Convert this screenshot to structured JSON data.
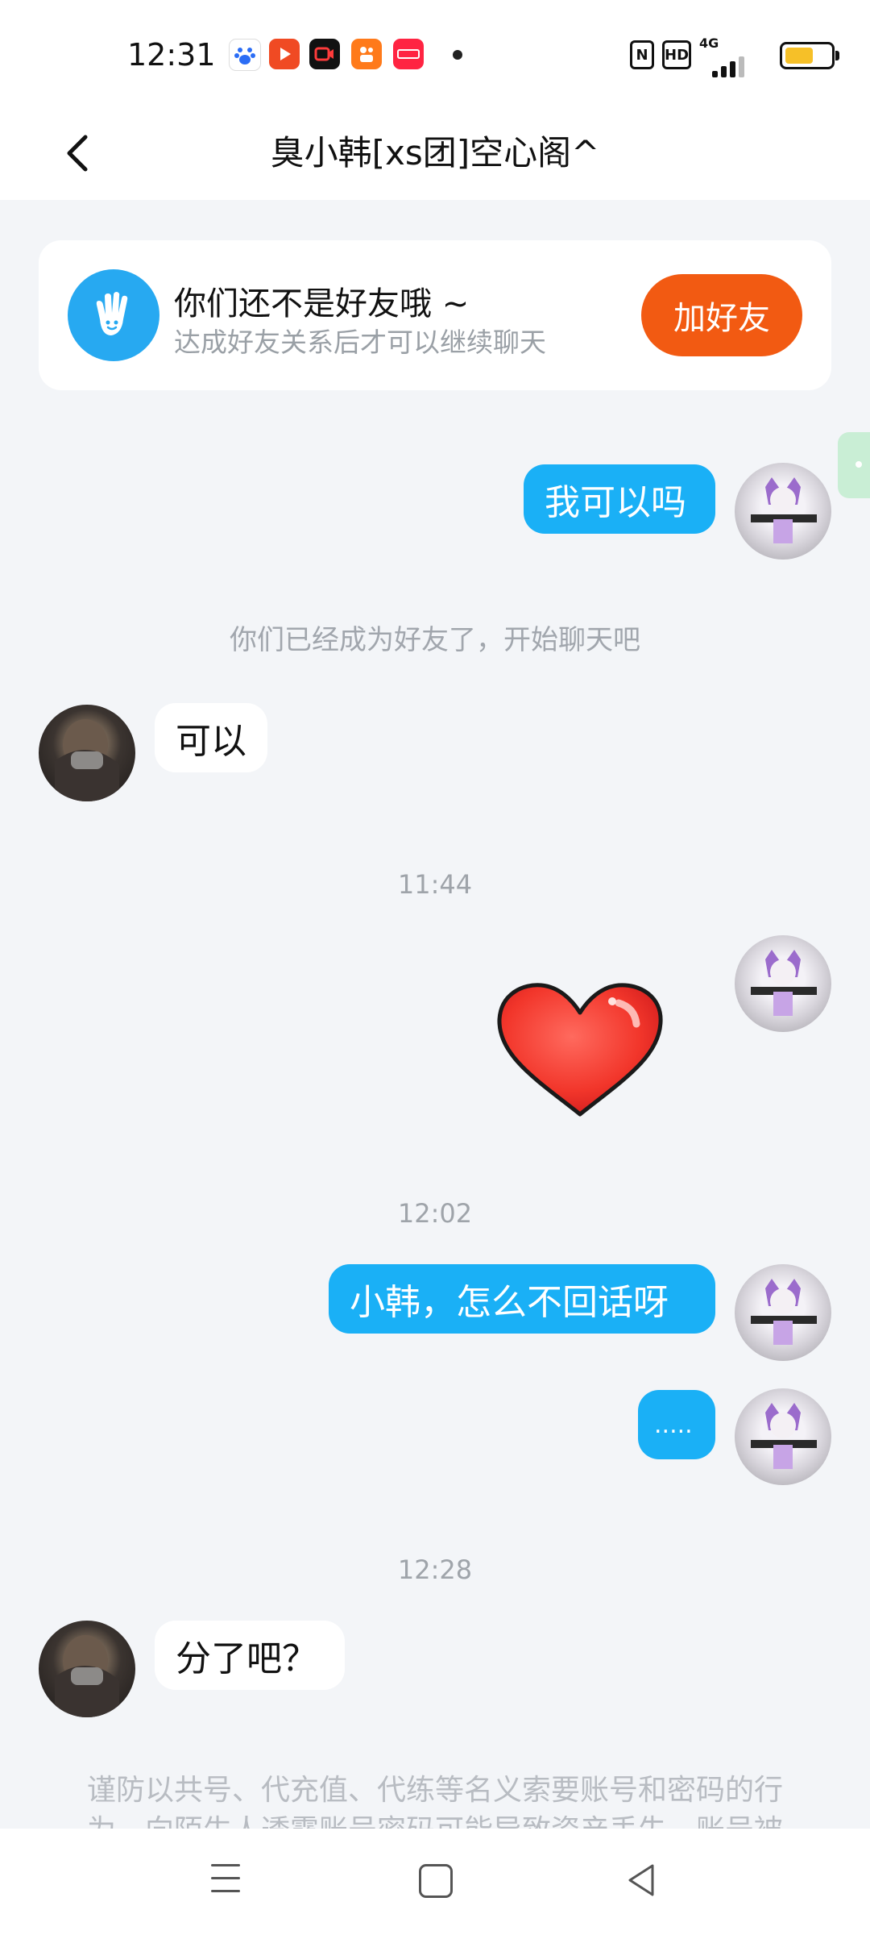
{
  "status_bar": {
    "time": "12:31",
    "apps": [
      {
        "icon": "baidu-icon",
        "color": "#2b6df5"
      },
      {
        "icon": "video-player-icon",
        "color": "#f04a23"
      },
      {
        "icon": "camera-recorder-icon",
        "color": "#111111"
      },
      {
        "icon": "kuaishou-icon",
        "color": "#ff7a1a"
      },
      {
        "icon": "xiaohongshu-icon",
        "color": "#ff2442"
      }
    ],
    "nfc": "N",
    "hd": "HD",
    "network": "4G"
  },
  "header": {
    "title": "臭小韩[xs团]空心阁^"
  },
  "friend_card": {
    "title": "你们还不是好友哦 ~",
    "subtitle": "达成好友关系后才可以继续聊天",
    "button": "加好友"
  },
  "messages": [
    {
      "side": "out",
      "text": "我可以吗"
    },
    {
      "system": "你们已经成为好友了，开始聊天吧"
    },
    {
      "side": "in",
      "text": "可以"
    },
    {
      "time": "11:44"
    },
    {
      "side": "out",
      "sticker": "red-heart"
    },
    {
      "time": "12:02"
    },
    {
      "side": "out",
      "text": "小韩，怎么不回话呀"
    },
    {
      "side": "out",
      "text": "....."
    },
    {
      "time": "12:28"
    },
    {
      "side": "in",
      "text": "分了吧？"
    }
  ],
  "warning": "谨防以共号、代充值、代练等名义索要账号和密码的行为，向陌生人透露账号密码可能导致资产丢失，账号被",
  "nav": {
    "items": [
      "menu-icon",
      "home-icon",
      "back-icon"
    ]
  }
}
